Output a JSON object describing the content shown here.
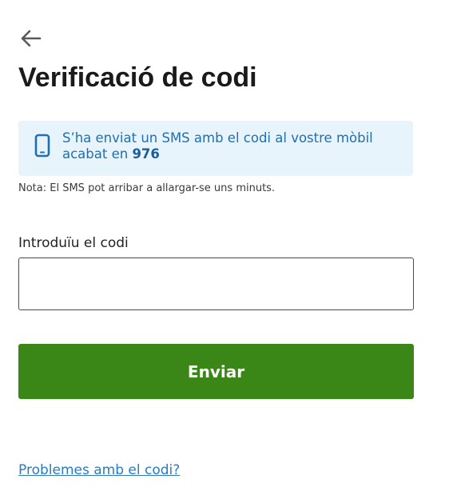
{
  "header": {
    "back_icon": "arrow-left-icon",
    "title": "Verificació de codi"
  },
  "info": {
    "icon": "mobile-phone-icon",
    "message_prefix": "S’ha enviat un SMS amb el codi al vostre mòbil acabat en ",
    "last_digits": "976",
    "accent_color": "#1f6fb2",
    "background_color": "#e8f4fb"
  },
  "note": "Nota: El SMS pot arribar a allargar-se uns minuts.",
  "form": {
    "code_label": "Introduïu el codi",
    "code_value": "",
    "submit_label": "Enviar",
    "submit_color": "#3a8616"
  },
  "help_link": "Problemes amb el codi?"
}
